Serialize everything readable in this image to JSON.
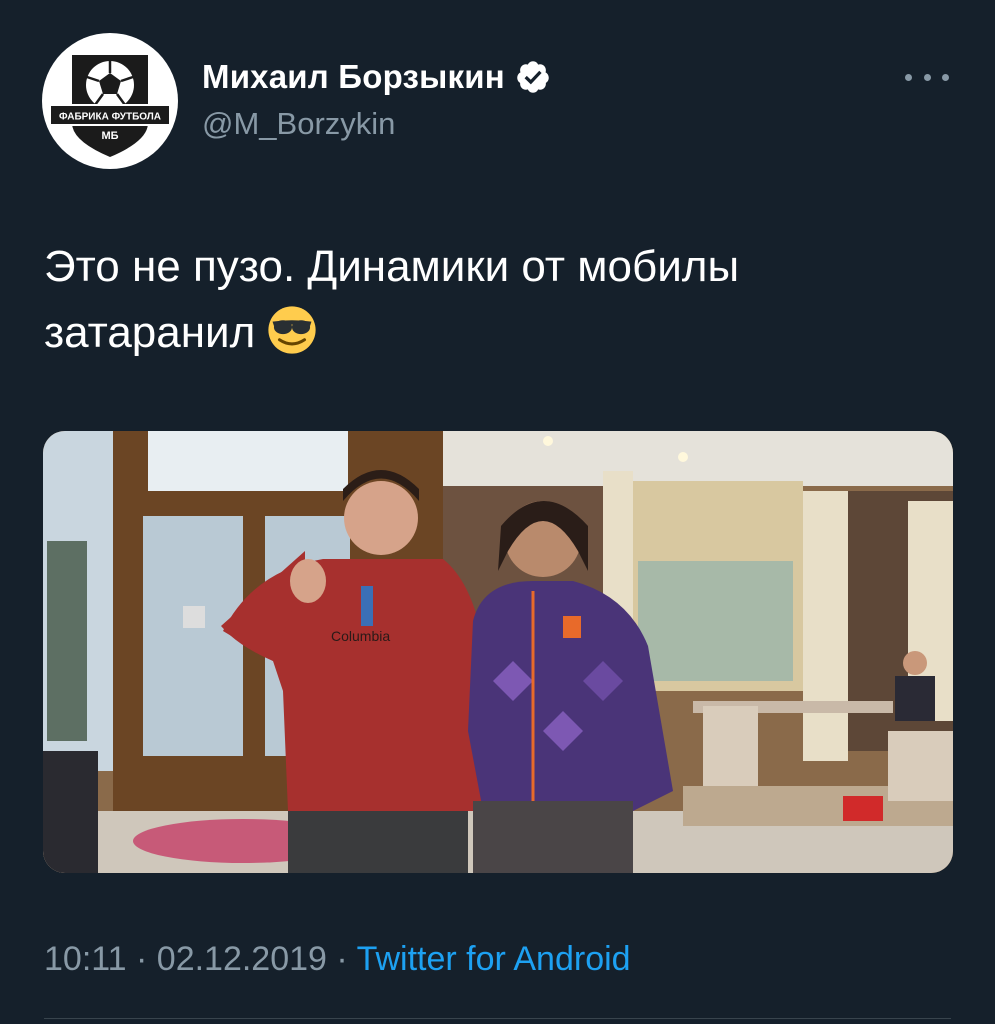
{
  "author": {
    "display_name": "Михаил Борзыкин",
    "handle": "@M_Borzykin",
    "verified": true,
    "avatar_text_top": "ФАБРИКА ФУТБОЛА",
    "avatar_text_bottom": "МБ"
  },
  "tweet": {
    "text": "Это не пузо. Динамики от мобилы затаранил",
    "emoji": "smiling-face-with-sunglasses",
    "photo_text": "Columbia"
  },
  "meta": {
    "time": "10:11",
    "separator": " · ",
    "date": "02.12.2019",
    "source": "Twitter for Android"
  },
  "colors": {
    "background": "#15202b",
    "text_primary": "#ffffff",
    "text_secondary": "#8899a6",
    "accent": "#1da1f2",
    "divider": "#38444d"
  }
}
